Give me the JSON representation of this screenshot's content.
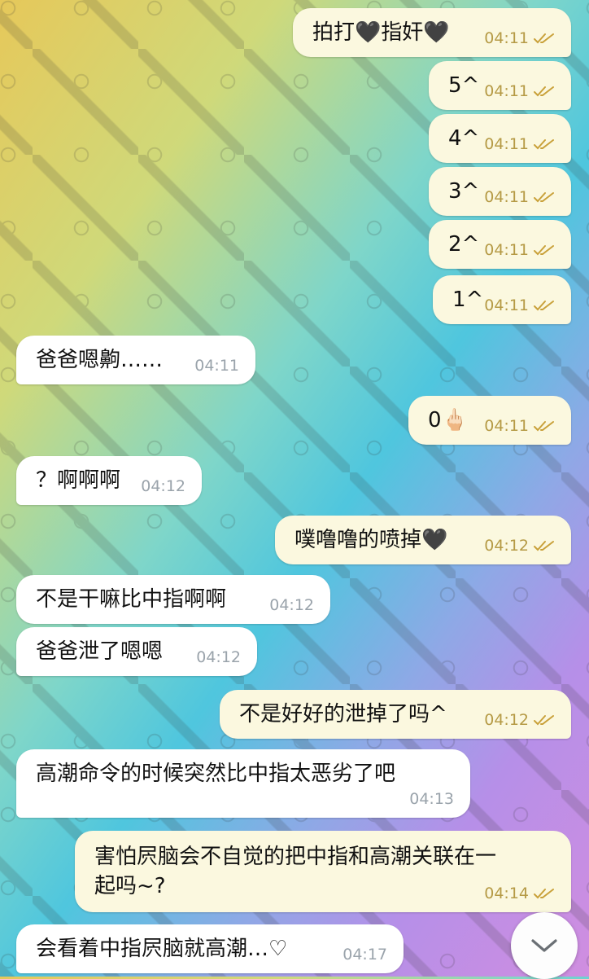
{
  "messages": [
    {
      "dir": "out",
      "text": "拍打🖤指奸🖤",
      "time": "04:11"
    },
    {
      "dir": "out",
      "text": "5^",
      "time": "04:11"
    },
    {
      "dir": "out",
      "text": "4^",
      "time": "04:11"
    },
    {
      "dir": "out",
      "text": "3^",
      "time": "04:11"
    },
    {
      "dir": "out",
      "text": "2^",
      "time": "04:11"
    },
    {
      "dir": "out",
      "text": "1^",
      "time": "04:11"
    },
    {
      "dir": "in",
      "text": "爸爸嗯齁……",
      "time": "04:11"
    },
    {
      "dir": "out",
      "text": "0🖕🏻",
      "time": "04:11"
    },
    {
      "dir": "in",
      "text": "？啊啊啊",
      "time": "04:12"
    },
    {
      "dir": "out",
      "text": "噗噜噜的喷掉🖤",
      "time": "04:12"
    },
    {
      "dir": "in",
      "text": "不是干嘛比中指啊啊",
      "time": "04:12"
    },
    {
      "dir": "in",
      "text": "爸爸泄了嗯嗯",
      "time": "04:12"
    },
    {
      "dir": "out",
      "text": "不是好好的泄掉了吗^",
      "time": "04:12"
    },
    {
      "dir": "in",
      "text": "高潮命令的时候突然比中指太恶劣了吧",
      "time": "04:13"
    },
    {
      "dir": "out",
      "text": "害怕屄脑会不自觉的把中指和高潮关联在一",
      "text_line2": "起吗~?",
      "time": "04:14"
    },
    {
      "dir": "in",
      "text": "会看着中指屄脑就高潮…♡",
      "time": "04:17"
    }
  ],
  "icons": {
    "read_receipt": "double-check-icon",
    "scroll": "chevron-down-icon"
  },
  "colors": {
    "incoming_bubble": "#ffffff",
    "outgoing_bubble": "#fbf8df",
    "outgoing_meta": "#b59a45",
    "incoming_meta": "#9aa3ab"
  }
}
